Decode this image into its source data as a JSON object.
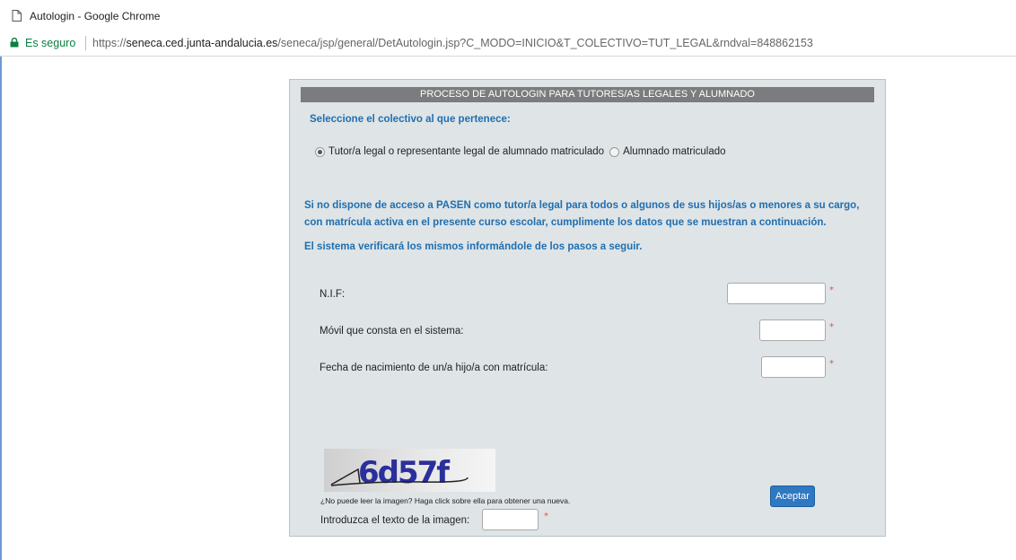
{
  "window": {
    "title": "Autologin - Google Chrome"
  },
  "address_bar": {
    "secure_label": "Es seguro",
    "url_scheme": "https://",
    "url_host": "seneca.ced.junta-andalucia.es",
    "url_path": "/seneca/jsp/general/DetAutologin.jsp?C_MODO=INICIO&T_COLECTIVO=TUT_LEGAL&rndval=848862153"
  },
  "form": {
    "header": "PROCESO DE AUTOLOGIN PARA TUTORES/AS LEGALES Y ALUMNADO",
    "collective_prompt": "Seleccione el colectivo al que pertenece:",
    "options": [
      {
        "label": "Tutor/a legal o representante legal de alumnado matriculado",
        "checked": true
      },
      {
        "label": "Alumnado matriculado",
        "checked": false
      }
    ],
    "info_1": "Si no dispone de acceso a PASEN como tutor/a legal para todos o algunos de sus hijos/as o menores a su cargo, con matrícula activa en el presente curso escolar, cumplimente los datos que se muestran a continuación.",
    "info_2": "El sistema verificará los mismos informándole de los pasos a seguir.",
    "fields": {
      "nif_label": "N.I.F:",
      "mobile_label": "Móvil que consta en el sistema:",
      "birthdate_label": "Fecha de nacimiento de un/a hijo/a con matrícula:",
      "required_mark": "*"
    },
    "captcha": {
      "text": "6d57f",
      "hint": "¿No puede leer la imagen? Haga click sobre ella para obtener una nueva.",
      "input_label": "Introduzca el texto de la imagen:"
    },
    "submit_label": "Aceptar"
  },
  "colors": {
    "header_bg": "#7a7c7d",
    "panel_bg": "#dfe4e6",
    "accent_text": "#1f6fb0",
    "button": "#2f78c2",
    "required": "#e05050"
  }
}
